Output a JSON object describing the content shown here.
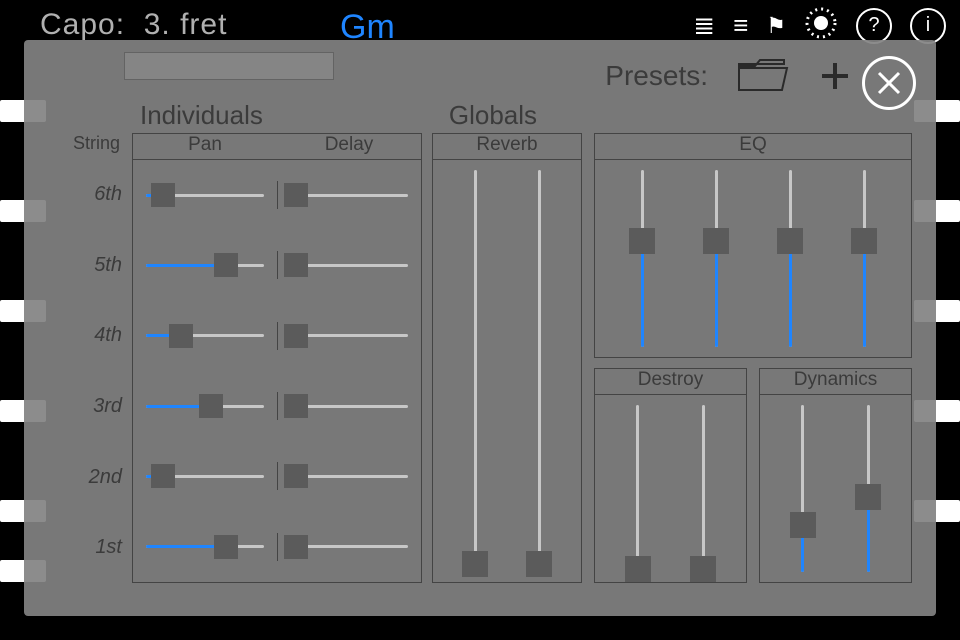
{
  "topbar": {
    "capo_label": "Capo:",
    "capo_value": "3. fret",
    "chord": "Gm"
  },
  "panel": {
    "presets_label": "Presets:",
    "sections": {
      "individuals": "Individuals",
      "globals": "Globals"
    },
    "columns": {
      "string": "String",
      "pan": "Pan",
      "delay": "Delay",
      "reverb": "Reverb",
      "eq": "EQ",
      "destroy": "Destroy",
      "dynamics": "Dynamics"
    },
    "string_labels": [
      "6th",
      "5th",
      "4th",
      "3rd",
      "2nd",
      "1st"
    ],
    "pan": [
      0.15,
      0.68,
      0.3,
      0.55,
      0.15,
      0.68
    ],
    "delay": [
      0.05,
      0.05,
      0.05,
      0.05,
      0.05,
      0.05
    ],
    "reverb": [
      0.02,
      0.02
    ],
    "eq": [
      0.6,
      0.6,
      0.6,
      0.6
    ],
    "destroy": [
      0.02,
      0.02
    ],
    "dynamics": [
      0.28,
      0.45
    ],
    "accent": "#1f85ff",
    "thumb_color": "#5b5b5b"
  }
}
